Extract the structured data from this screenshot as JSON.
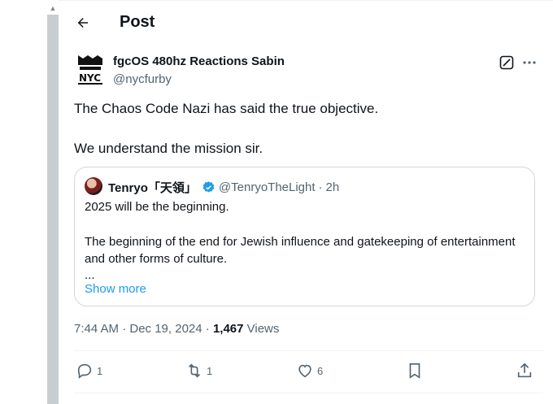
{
  "header": {
    "title": "Post"
  },
  "post": {
    "author_name": "fgcOS 480hz Reactions Sabin",
    "author_handle": "@nycfurby",
    "text_p1": "The Chaos Code Nazi has said the true objective.",
    "text_p2": "We understand the mission sir.",
    "timestamp": "7:44 AM · Dec 19, 2024 · ",
    "views_count": "1,467",
    "views_label": " Views"
  },
  "quote": {
    "author_name": "Tenryo「天領」",
    "author_handle": "@TenryoTheLight",
    "separator": "·",
    "time": "2h",
    "line1": "2025 will be the beginning.",
    "line2": "The beginning of the end for Jewish influence and gatekeeping of entertainment and other forms of culture.",
    "line3": "...",
    "show_more": "Show more"
  },
  "actions": {
    "replies": "1",
    "reposts": "1",
    "likes": "6"
  },
  "colors": {
    "accent": "#1d9bf0",
    "secondary_text": "#536471",
    "primary_text": "#0f1419",
    "border": "#cfd9de"
  }
}
